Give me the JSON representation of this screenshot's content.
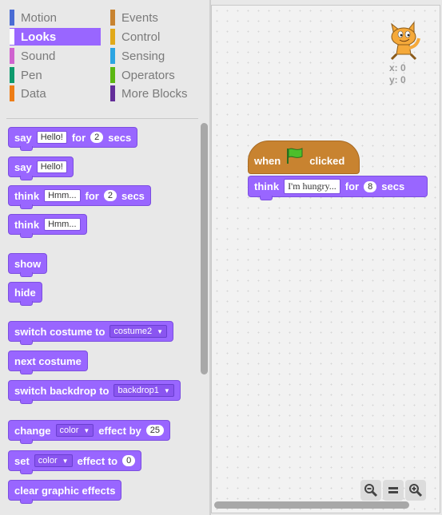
{
  "categories": {
    "left": [
      {
        "label": "Motion",
        "color": "#4a6cd4"
      },
      {
        "label": "Looks",
        "color": "#9966ff"
      },
      {
        "label": "Sound",
        "color": "#cf63cf"
      },
      {
        "label": "Pen",
        "color": "#0e9a6c"
      },
      {
        "label": "Data",
        "color": "#ee7d16"
      }
    ],
    "right": [
      {
        "label": "Events",
        "color": "#c88330"
      },
      {
        "label": "Control",
        "color": "#e1a91a"
      },
      {
        "label": "Sensing",
        "color": "#2ca5e2"
      },
      {
        "label": "Operators",
        "color": "#5cb712"
      },
      {
        "label": "More Blocks",
        "color": "#632d99"
      }
    ],
    "selected": "Looks"
  },
  "palette": {
    "say_secs": {
      "say": "say",
      "text": "Hello!",
      "for": "for",
      "num": "2",
      "secs": "secs"
    },
    "say": {
      "say": "say",
      "text": "Hello!"
    },
    "think_secs": {
      "think": "think",
      "text": "Hmm...",
      "for": "for",
      "num": "2",
      "secs": "secs"
    },
    "think": {
      "think": "think",
      "text": "Hmm..."
    },
    "show": "show",
    "hide": "hide",
    "switch_costume": {
      "label": "switch costume to",
      "value": "costume2"
    },
    "next_costume": "next costume",
    "switch_backdrop": {
      "label": "switch backdrop to",
      "value": "backdrop1"
    },
    "change_effect": {
      "change": "change",
      "value": "color",
      "effect_by": "effect by",
      "num": "25"
    },
    "set_effect": {
      "set": "set",
      "value": "color",
      "effect_to": "effect to",
      "num": "0"
    },
    "clear_effects": "clear graphic effects"
  },
  "script": {
    "hat": {
      "when": "when",
      "clicked": "clicked"
    },
    "think": {
      "think": "think",
      "text": "I'm hungry...",
      "for": "for",
      "num": "8",
      "secs": "secs"
    }
  },
  "sprite": {
    "x_label": "x:",
    "x": "0",
    "y_label": "y:",
    "y": "0"
  },
  "zoom": {
    "out": "−",
    "reset": "=",
    "in": "+"
  }
}
